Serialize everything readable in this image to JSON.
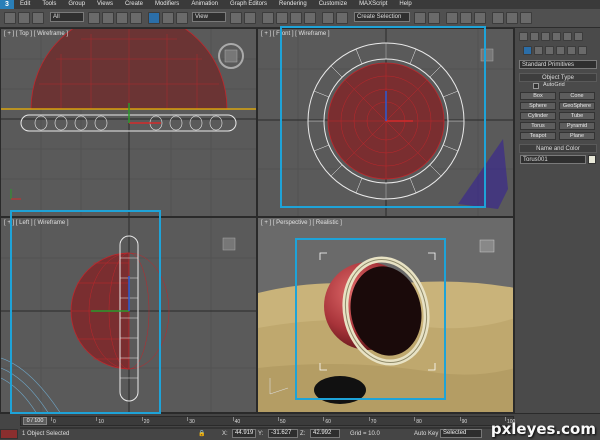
{
  "menubar": {
    "items": [
      "Edit",
      "Tools",
      "Group",
      "Views",
      "Create",
      "Modifiers",
      "Animation",
      "Graph Editors",
      "Rendering",
      "Customize",
      "MAXScript",
      "Help"
    ]
  },
  "toolbar": {
    "filter_value": "All",
    "refcoord_value": "View",
    "selection_set_value": "Create Selection"
  },
  "viewports": {
    "top": "[ + ] [ Top ] [ Wireframe ]",
    "front": "[ + ] [ Front ] [ Wireframe ]",
    "left": "[ + ] [ Left ] [ Wireframe ]",
    "perspective": "[ + ] [ Perspective ] [ Realistic ]"
  },
  "command_panel": {
    "category_value": "Standard Primitives",
    "object_type_title": "Object Type",
    "autogrid_label": "AutoGrid",
    "buttons": [
      "Box",
      "Cone",
      "Sphere",
      "GeoSphere",
      "Cylinder",
      "Tube",
      "Torus",
      "Pyramid",
      "Teapot",
      "Plane"
    ],
    "name_color_title": "Name and Color",
    "object_name": "Torus001"
  },
  "timeline": {
    "frame_label": "0 / 100",
    "ticks": [
      "0",
      "10",
      "20",
      "30",
      "40",
      "50",
      "60",
      "70",
      "80",
      "90",
      "100"
    ]
  },
  "status": {
    "selection_text": "1 Object Selected",
    "x_label": "X:",
    "x_value": "44.919",
    "y_label": "Y:",
    "y_value": "-31.627",
    "z_label": "Z:",
    "z_value": "42.992",
    "grid_text": "Grid = 10.0",
    "autokey_label": "Auto Key",
    "selected_value": "Selected"
  },
  "watermark": "pxleyes.com",
  "colors": {
    "highlight": "#1ea3d8",
    "wire_red": "#c0262b",
    "sand": "#c9b37a"
  }
}
